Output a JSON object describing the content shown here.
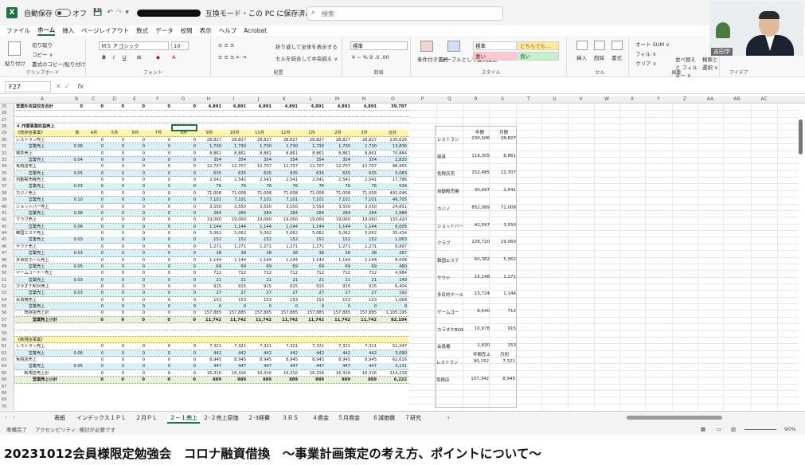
{
  "titlebar": {
    "autosave_label": "自動保存",
    "autosave_state": "オフ",
    "doc_title": "互換モード・この PC に保存済み ∨",
    "search_placeholder": "検索"
  },
  "menu": [
    "ファイル",
    "ホーム",
    "挿入",
    "ページレイアウト",
    "数式",
    "データ",
    "校閲",
    "表示",
    "ヘルプ",
    "Acrobat"
  ],
  "menu_active": "ホーム",
  "ribbon": {
    "clipboard": {
      "paste": "貼り付け",
      "cut": "切り取り",
      "copy": "コピー ∨",
      "format_painter": "書式のコピー/貼り付け",
      "label": "クリップボード"
    },
    "font": {
      "name": "ＭＳ Ｐゴシック",
      "size": "10",
      "label": "フォント"
    },
    "alignment": {
      "wrap": "折り返して全体を表示する",
      "merge": "セルを結合して中央揃え ∨",
      "label": "配置"
    },
    "number": {
      "format": "標準",
      "label": "数値"
    },
    "styles": {
      "cond": "条件付き書式",
      "table": "テーブルとして書式設定",
      "cell_normal": "標準",
      "cell_neutral": "どちらでも…",
      "cell_bad": "悪い",
      "cell_good": "良い",
      "label": "スタイル"
    },
    "cells": {
      "insert": "挿入",
      "delete": "削除",
      "format": "書式",
      "label": "セル"
    },
    "editing": {
      "autosum": "オート SUM ∨",
      "fill": "フィル ∨",
      "clear": "クリア ∨",
      "sort": "並べ替えと フィルター ∨",
      "find": "検索と 選択 ∨",
      "label": "編集"
    },
    "ideas": {
      "label": "アイデア"
    }
  },
  "webcam_name": "吉田学",
  "formula": {
    "cell": "F27",
    "fx": "fx"
  },
  "columns": [
    "A",
    "B",
    "C",
    "D",
    "E",
    "F",
    "G",
    "H",
    "I",
    "J",
    "K",
    "L",
    "M",
    "N",
    "O",
    "P",
    "Q",
    "R",
    "S",
    "T",
    "U",
    "V",
    "W",
    "X",
    "Y",
    "Z",
    "AA",
    "AB",
    "AC"
  ],
  "row_numbers": [
    "25",
    "26",
    "27",
    "28",
    "29",
    "30",
    "31",
    "32",
    "33",
    "34",
    "35",
    "36",
    "37",
    "38",
    "39",
    "40",
    "41",
    "42",
    "43",
    "44",
    "45",
    "46",
    "47",
    "48",
    "49",
    "50",
    "51",
    "52",
    "53",
    "54",
    "55",
    "56",
    "57",
    "58",
    "59",
    "60",
    "61",
    "62",
    "63",
    "64",
    "65",
    "66",
    "67",
    "68",
    "69",
    "70"
  ],
  "rows": [
    {
      "a": "営業外収益収支合計",
      "cls": "bold",
      "v": [
        "0",
        "0",
        "0",
        "0",
        "0",
        "0",
        "4,891",
        "4,891",
        "4,891",
        "4,891",
        "4,891",
        "4,891",
        "4,891",
        "39,787"
      ]
    },
    {
      "a": "",
      "cls": "",
      "v": []
    },
    {
      "a": "",
      "cls": "",
      "v": []
    },
    {
      "a": "４.作業事業収益売上",
      "cls": "bold",
      "v": []
    },
    {
      "a": "《既存店事業》",
      "cls": "yellow",
      "v": [
        "率",
        "4月",
        "5月",
        "6月",
        "7月",
        "8月",
        "9月",
        "10月",
        "11月",
        "12月",
        "1月",
        "2月",
        "3月",
        "合計"
      ]
    },
    {
      "a": "レストラン売上",
      "cls": "",
      "v": [
        "",
        "0",
        "0",
        "0",
        "0",
        "0",
        "28,827",
        "28,827",
        "28,827",
        "28,827",
        "28,827",
        "28,827",
        "28,827",
        "230,616"
      ]
    },
    {
      "a": "　　　営業売上",
      "cls": "lblue",
      "v": [
        "0.06",
        "0",
        "0",
        "0",
        "0",
        "0",
        "1,730",
        "1,730",
        "1,730",
        "1,730",
        "1,730",
        "1,730",
        "1,730",
        "13,836"
      ]
    },
    {
      "a": "喫茶売上",
      "cls": "",
      "v": [
        "",
        "0",
        "0",
        "0",
        "0",
        "0",
        "8,861",
        "8,861",
        "8,861",
        "8,861",
        "8,861",
        "8,861",
        "8,861",
        "70,884"
      ]
    },
    {
      "a": "　　　営業売上",
      "cls": "lblue",
      "v": [
        "0.04",
        "0",
        "0",
        "0",
        "0",
        "0",
        "354",
        "354",
        "354",
        "354",
        "354",
        "354",
        "354",
        "2,835"
      ]
    },
    {
      "a": "免税店売上",
      "cls": "",
      "v": [
        "",
        "0",
        "0",
        "0",
        "0",
        "0",
        "12,707",
        "12,707",
        "12,707",
        "12,707",
        "12,707",
        "12,707",
        "12,707",
        "88,955"
      ]
    },
    {
      "a": "　　　営業売上",
      "cls": "lblue",
      "v": [
        "0.05",
        "0",
        "0",
        "0",
        "0",
        "0",
        "635",
        "635",
        "635",
        "635",
        "635",
        "635",
        "635",
        "5,083"
      ]
    },
    {
      "a": "自動販売機売上",
      "cls": "",
      "v": [
        "",
        "0",
        "0",
        "0",
        "0",
        "0",
        "2,541",
        "2,541",
        "2,541",
        "2,541",
        "2,541",
        "2,541",
        "2,541",
        "17,786"
      ]
    },
    {
      "a": "　　　営業売上",
      "cls": "lblue",
      "v": [
        "0.03",
        "0",
        "0",
        "0",
        "0",
        "0",
        "76",
        "76",
        "76",
        "76",
        "76",
        "76",
        "76",
        "534"
      ]
    },
    {
      "a": "カジノ売上",
      "cls": "",
      "v": [
        "",
        "0",
        "0",
        "0",
        "0",
        "0",
        "71,008",
        "71,008",
        "71,008",
        "71,008",
        "71,008",
        "71,008",
        "71,008",
        "492,046"
      ]
    },
    {
      "a": "　　　営業売上",
      "cls": "lblue",
      "v": [
        "0.10",
        "0",
        "0",
        "0",
        "0",
        "0",
        "7,101",
        "7,101",
        "7,101",
        "7,101",
        "7,101",
        "7,101",
        "7,101",
        "49,705"
      ]
    },
    {
      "a": "ショットバー売上",
      "cls": "",
      "v": [
        "",
        "0",
        "0",
        "0",
        "0",
        "0",
        "3,550",
        "3,550",
        "3,550",
        "3,550",
        "3,550",
        "3,550",
        "3,550",
        "24,851"
      ]
    },
    {
      "a": "　　　営業売上",
      "cls": "lblue",
      "v": [
        "0.08",
        "0",
        "0",
        "0",
        "0",
        "0",
        "284",
        "284",
        "284",
        "284",
        "284",
        "284",
        "284",
        "1,988"
      ]
    },
    {
      "a": "クラブ売上",
      "cls": "",
      "v": [
        "",
        "0",
        "0",
        "0",
        "0",
        "0",
        "19,060",
        "19,060",
        "19,060",
        "19,060",
        "19,060",
        "19,060",
        "19,060",
        "133,420"
      ]
    },
    {
      "a": "　　　営業売上",
      "cls": "lblue",
      "v": [
        "0.06",
        "0",
        "0",
        "0",
        "0",
        "0",
        "1,144",
        "1,144",
        "1,144",
        "1,144",
        "1,144",
        "1,144",
        "1,144",
        "8,005"
      ]
    },
    {
      "a": "韓国エステ売上",
      "cls": "",
      "v": [
        "",
        "0",
        "0",
        "0",
        "0",
        "0",
        "5,062",
        "5,062",
        "5,062",
        "5,062",
        "5,062",
        "5,062",
        "5,062",
        "35,434"
      ]
    },
    {
      "a": "　　　営業売上",
      "cls": "lblue",
      "v": [
        "0.03",
        "0",
        "0",
        "0",
        "0",
        "0",
        "152",
        "152",
        "152",
        "152",
        "152",
        "152",
        "152",
        "1,063"
      ]
    },
    {
      "a": "サウナ売上",
      "cls": "",
      "v": [
        "",
        "0",
        "0",
        "0",
        "0",
        "0",
        "1,271",
        "1,271",
        "1,271",
        "1,271",
        "1,271",
        "1,271",
        "1,271",
        "8,897"
      ]
    },
    {
      "a": "　　　営業売上",
      "cls": "lblue",
      "v": [
        "0.03",
        "0",
        "0",
        "0",
        "0",
        "0",
        "38",
        "38",
        "38",
        "38",
        "38",
        "38",
        "38",
        "267"
      ]
    },
    {
      "a": "多目的ホール売上",
      "cls": "",
      "v": [
        "",
        "0",
        "0",
        "0",
        "0",
        "0",
        "1,144",
        "1,144",
        "1,144",
        "1,144",
        "1,144",
        "1,144",
        "1,144",
        "8,008"
      ]
    },
    {
      "a": "　　　営業売上",
      "cls": "lblue",
      "v": [
        "0.05",
        "0",
        "0",
        "0",
        "0",
        "0",
        "69",
        "69",
        "69",
        "69",
        "69",
        "69",
        "69",
        "480"
      ]
    },
    {
      "a": "ゲームコーナー売上",
      "cls": "",
      "v": [
        "",
        "0",
        "0",
        "0",
        "0",
        "0",
        "712",
        "712",
        "712",
        "712",
        "712",
        "712",
        "712",
        "4,984"
      ]
    },
    {
      "a": "　　　営業売上",
      "cls": "lblue",
      "v": [
        "0.03",
        "0",
        "0",
        "0",
        "0",
        "0",
        "21",
        "21",
        "21",
        "21",
        "21",
        "21",
        "21",
        "149"
      ]
    },
    {
      "a": "カラオケBOX売上",
      "cls": "",
      "v": [
        "",
        "0",
        "0",
        "0",
        "0",
        "0",
        "915",
        "915",
        "915",
        "915",
        "915",
        "915",
        "915",
        "6,404"
      ]
    },
    {
      "a": "　　　営業売上",
      "cls": "lblue",
      "v": [
        "0.03",
        "0",
        "0",
        "0",
        "0",
        "0",
        "27",
        "27",
        "27",
        "27",
        "27",
        "27",
        "27",
        "192"
      ]
    },
    {
      "a": "会員権売上",
      "cls": "",
      "v": [
        "",
        "0",
        "0",
        "0",
        "0",
        "0",
        "153",
        "153",
        "153",
        "153",
        "153",
        "153",
        "153",
        "1,068"
      ]
    },
    {
      "a": "　　　営業売上",
      "cls": "lblue",
      "v": [
        "",
        "0",
        "0",
        "0",
        "0",
        "0",
        "0",
        "0",
        "0",
        "0",
        "0",
        "0",
        "0",
        "0"
      ]
    },
    {
      "a": "　　既存店売上計",
      "cls": "",
      "v": [
        "",
        "0",
        "0",
        "0",
        "0",
        "0",
        "157,885",
        "157,885",
        "157,885",
        "157,885",
        "157,885",
        "157,885",
        "157,885",
        "1,105,195"
      ]
    },
    {
      "a": "　　　　営業売上小計",
      "cls": "lgreen bold",
      "v": [
        "",
        "0",
        "0",
        "0",
        "0",
        "0",
        "11,742",
        "11,742",
        "11,742",
        "11,742",
        "11,742",
        "11,742",
        "11,742",
        "82,194"
      ]
    },
    {
      "a": "",
      "cls": "",
      "v": []
    },
    {
      "a": "",
      "cls": "",
      "v": []
    },
    {
      "a": "《新規店事業》",
      "cls": "yellow",
      "v": []
    },
    {
      "a": "レストラン売上",
      "cls": "",
      "v": [
        "",
        "0",
        "0",
        "0",
        "0",
        "0",
        "7,321",
        "7,321",
        "7,321",
        "7,321",
        "7,321",
        "7,321",
        "7,321",
        "51,247"
      ]
    },
    {
      "a": "　　　営業売上",
      "cls": "lblue",
      "v": [
        "0.06",
        "0",
        "0",
        "0",
        "0",
        "0",
        "442",
        "442",
        "442",
        "442",
        "442",
        "442",
        "442",
        "3,090"
      ]
    },
    {
      "a": "免税店売上",
      "cls": "",
      "v": [
        "",
        "0",
        "0",
        "0",
        "0",
        "0",
        "8,945",
        "8,945",
        "8,945",
        "8,945",
        "8,945",
        "8,945",
        "8,945",
        "62,616"
      ]
    },
    {
      "a": "　　　営業売上",
      "cls": "lblue",
      "v": [
        "0.05",
        "0",
        "0",
        "0",
        "0",
        "0",
        "447",
        "447",
        "447",
        "447",
        "447",
        "447",
        "447",
        "3,131"
      ]
    },
    {
      "a": "　　新規店売上計",
      "cls": "",
      "v": [
        "",
        "0",
        "0",
        "0",
        "0",
        "0",
        "16,316",
        "16,316",
        "16,316",
        "16,316",
        "16,316",
        "16,316",
        "16,316",
        "114,218"
      ]
    },
    {
      "a": "　　　　営業売上小計",
      "cls": "lgreen bold",
      "v": [
        "",
        "0",
        "0",
        "0",
        "0",
        "0",
        "889",
        "889",
        "889",
        "889",
        "889",
        "889",
        "889",
        "6,222"
      ]
    }
  ],
  "summary": {
    "head": [
      "年間",
      "月間"
    ],
    "items": [
      [
        "レストラン",
        "230,106",
        "28,827"
      ],
      [
        "喫茶",
        "118,305",
        "8,861"
      ],
      [
        "免税店売",
        "152,485",
        "12,707"
      ],
      [
        "自動販売機",
        "30,497",
        "2,541"
      ],
      [
        "カジノ",
        "852,089",
        "71,008"
      ],
      [
        "ショットバー",
        "42,597",
        "3,550"
      ],
      [
        "クラブ",
        "228,720",
        "19,060"
      ],
      [
        "韓国エステ",
        "60,382",
        "5,062"
      ],
      [
        "サウナ",
        "15,248",
        "1,271"
      ],
      [
        "多目的ホール",
        "13,724",
        "1,144"
      ],
      [
        "ゲームコー",
        "8,540",
        "712"
      ],
      [
        "カラオケBOX",
        "10,978",
        "915"
      ],
      [
        "会員権",
        "1,830",
        "153"
      ]
    ],
    "head2": [
      "年間売上",
      "月別"
    ],
    "items2": [
      [
        "レストラン",
        "90,152",
        "7,321"
      ],
      [
        "免税店",
        "107,342",
        "8,945"
      ]
    ]
  },
  "sheets": [
    "表紙",
    "インデックス",
    "１ＰＬ",
    "２月ＰＬ",
    "２－１売上",
    "２-２売上原価",
    "２-3経費",
    "３ＢＳ",
    "４資金",
    "５月資金",
    "６減価償",
    "７研究"
  ],
  "sheet_active": "２－１売上",
  "status": {
    "ready": "準備完了",
    "access": "アクセシビリティ: 検討が必要です",
    "zoom": "90%"
  },
  "caption": "20231012会員様限定勉強会　コロナ融資借換　～事業計画策定の考え方、ポイントについて～",
  "colors": {
    "excel_green": "#1e7145",
    "yellow": "#fff5a6",
    "light_green": "#e5f2d5",
    "light_blue": "#d9f0f4"
  }
}
